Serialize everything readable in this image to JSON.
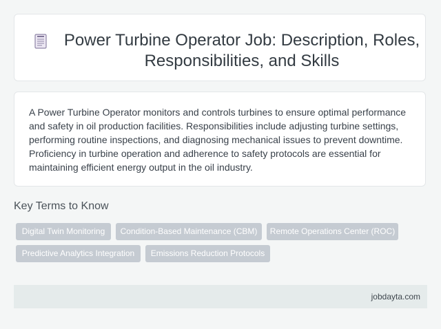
{
  "header": {
    "title": "Power Turbine Operator Job: Description, Roles, Responsibilities, and Skills",
    "icon": "document-icon"
  },
  "description": {
    "text": "A Power Turbine Operator monitors and controls turbines to ensure optimal performance and safety in oil production facilities. Responsibilities include adjusting turbine settings, performing routine inspections, and diagnosing mechanical issues to prevent downtime. Proficiency in turbine operation and adherence to safety protocols are essential for maintaining efficient energy output in the oil industry."
  },
  "key_terms": {
    "heading": "Key Terms to Know",
    "items": [
      "Digital Twin Monitoring",
      "Condition-Based Maintenance (CBM)",
      "Remote Operations Center (ROC)",
      "Predictive Analytics Integration",
      "Emissions Reduction Protocols"
    ]
  },
  "footer": {
    "site": "jobdayta.com"
  },
  "colors": {
    "background": "#f4f6f6",
    "card": "#ffffff",
    "tag": "#c5cbd2",
    "footer": "#e5ebeb"
  }
}
